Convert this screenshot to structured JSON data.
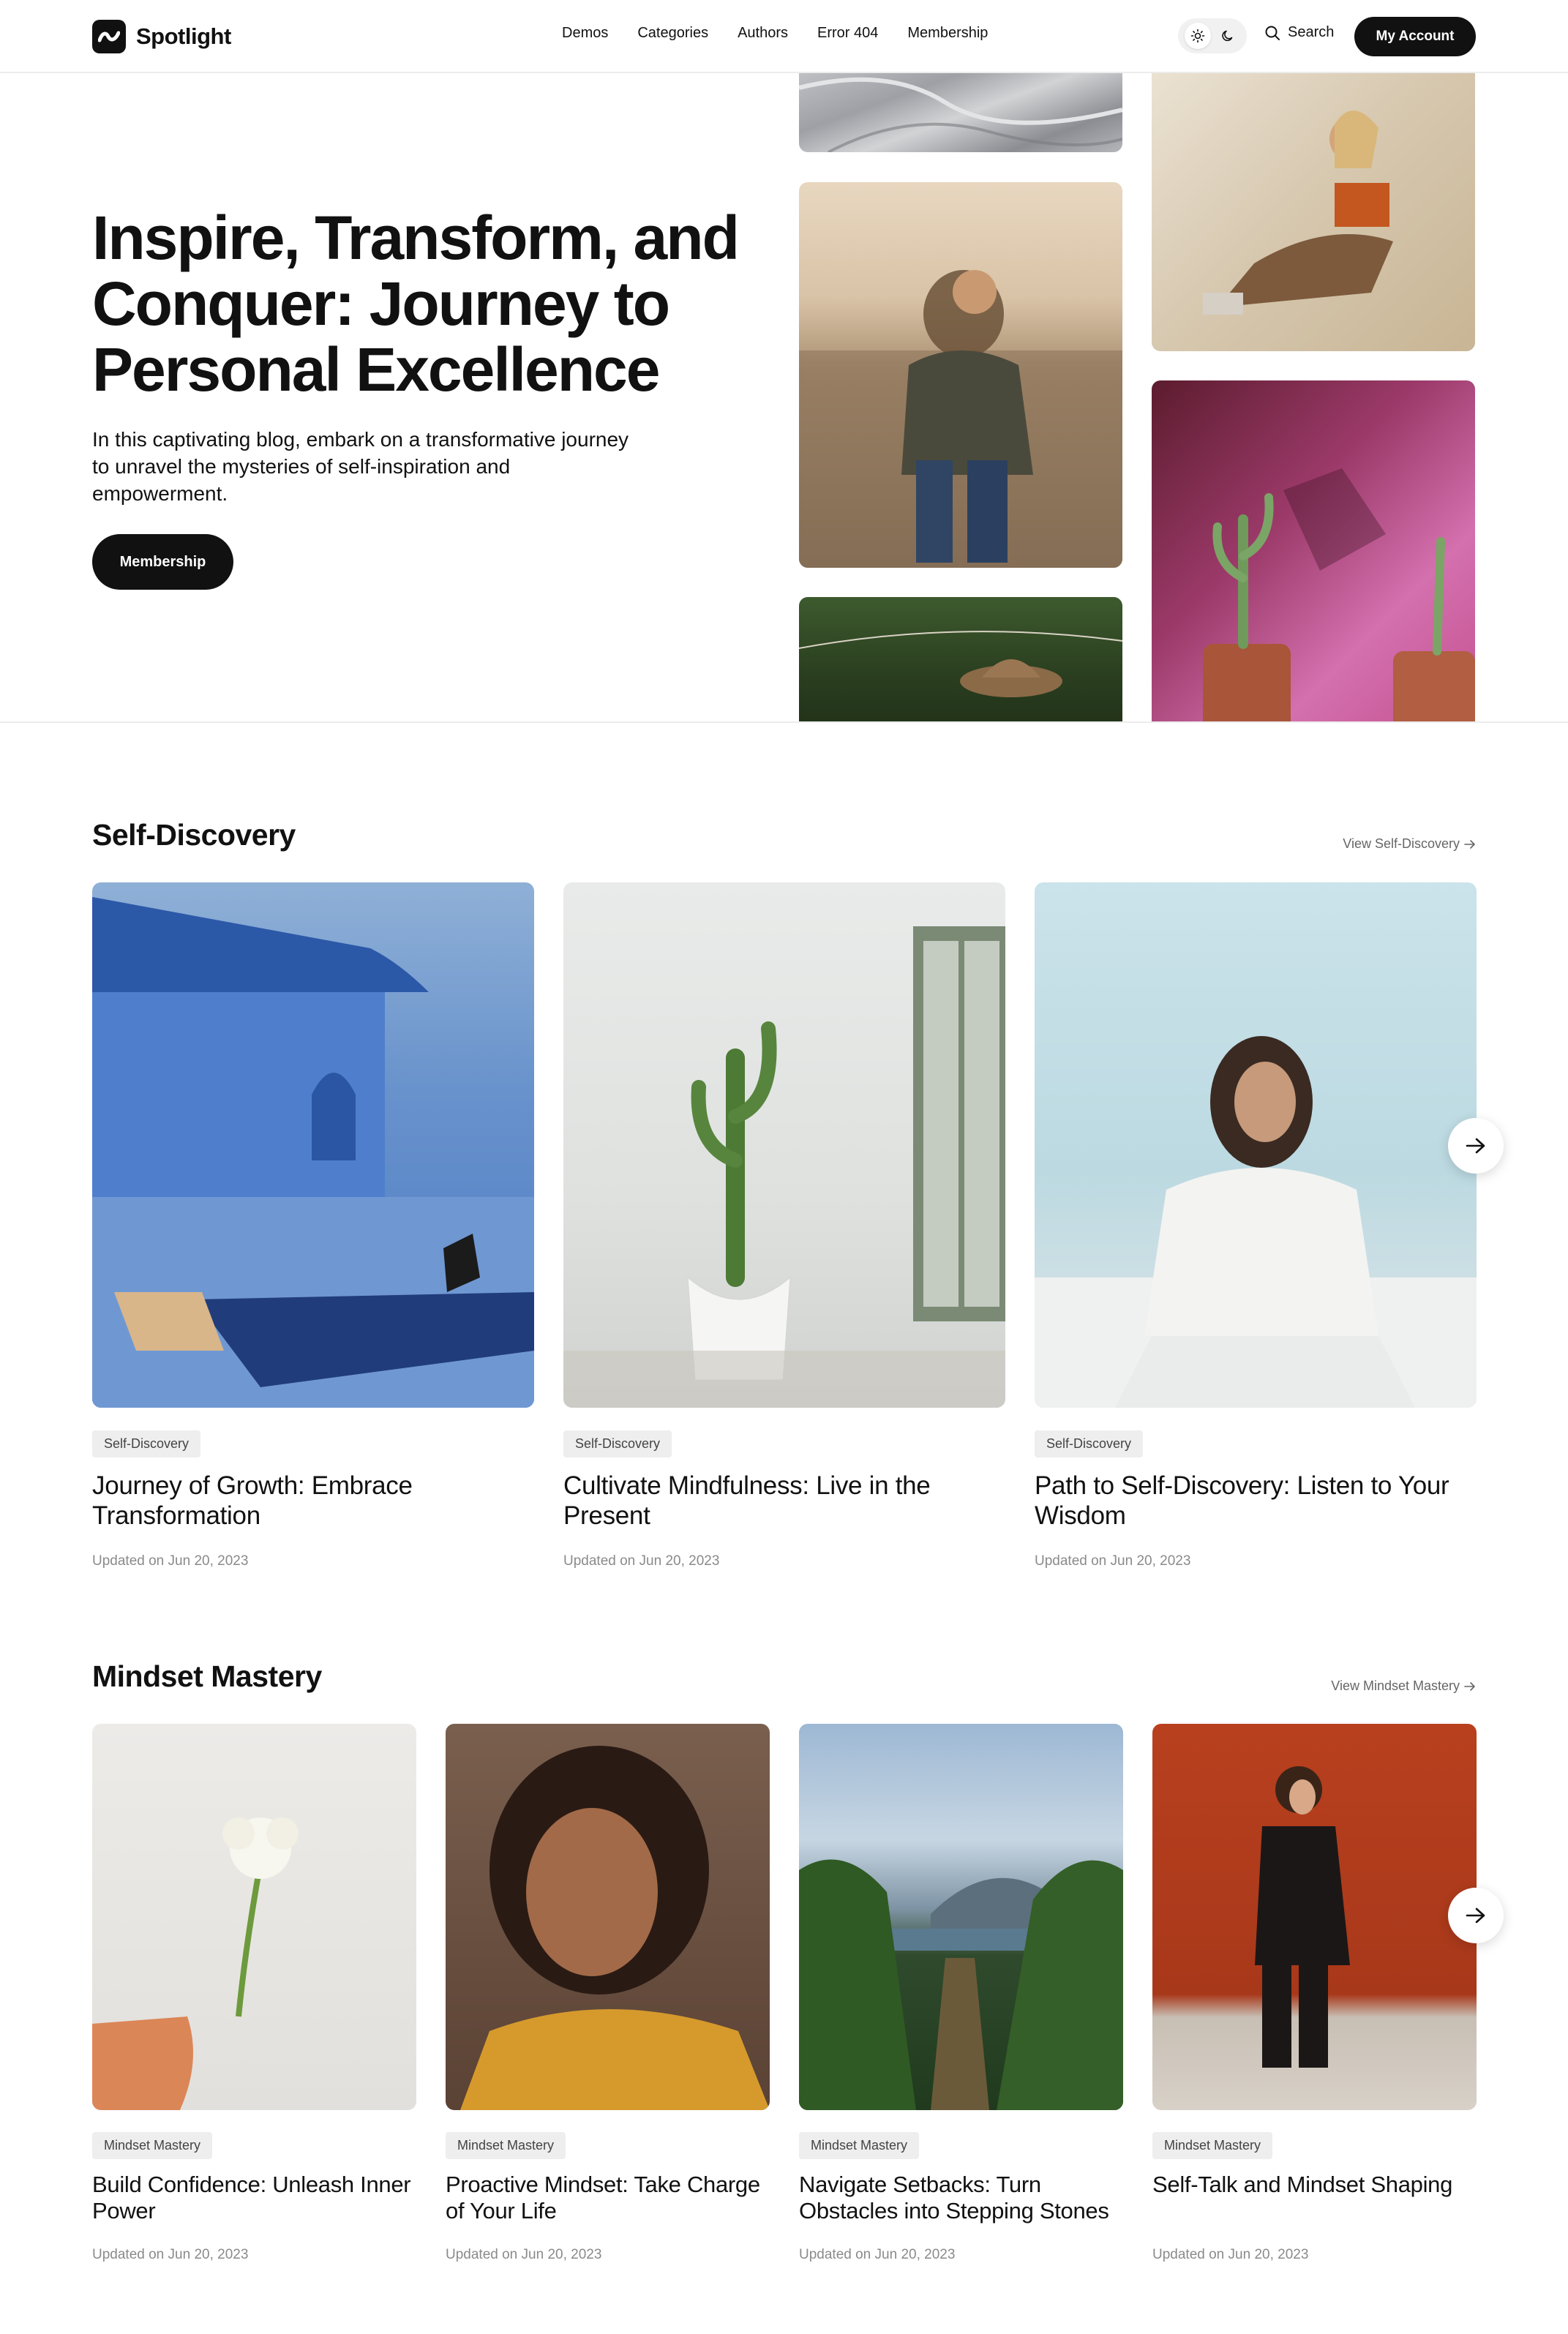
{
  "header": {
    "logo_text": "Spotlight",
    "nav": [
      "Demos",
      "Categories",
      "Authors",
      "Error 404",
      "Membership"
    ],
    "search_label": "Search",
    "account_label": "My Account"
  },
  "hero": {
    "title": "Inspire, Transform, and Conquer: Journey to Personal Excellence",
    "description": "In this captivating blog, embark on a transformative journey to unravel the mysteries of self-inspiration and empowerment.",
    "button_label": "Membership"
  },
  "sections": [
    {
      "title": "Self-Discovery",
      "view_link": "View Self-Discovery",
      "cards": [
        {
          "tag": "Self-Discovery",
          "title": "Journey of Growth: Embrace Transformation",
          "date_prefix": "Updated on",
          "date": "Jun 20, 2023"
        },
        {
          "tag": "Self-Discovery",
          "title": "Cultivate Mindfulness: Live in the Present",
          "date_prefix": "Updated on",
          "date": "Jun 20, 2023"
        },
        {
          "tag": "Self-Discovery",
          "title": "Path to Self-Discovery: Listen to Your Wisdom",
          "date_prefix": "Updated on",
          "date": "Jun 20, 2023"
        }
      ]
    },
    {
      "title": "Mindset Mastery",
      "view_link": "View Mindset Mastery",
      "cards": [
        {
          "tag": "Mindset Mastery",
          "title": "Build Confidence: Unleash Inner Power",
          "date_prefix": "Updated on",
          "date": "Jun 20, 2023"
        },
        {
          "tag": "Mindset Mastery",
          "title": "Proactive Mindset: Take Charge of Your Life",
          "date_prefix": "Updated on",
          "date": "Jun 20, 2023"
        },
        {
          "tag": "Mindset Mastery",
          "title": "Navigate Setbacks: Turn Obstacles into Stepping Stones",
          "date_prefix": "Updated on",
          "date": "Jun 20, 2023"
        },
        {
          "tag": "Mindset Mastery",
          "title": "Self-Talk and Mindset Shaping",
          "date_prefix": "Updated on",
          "date": "Jun 20, 2023"
        }
      ]
    }
  ],
  "icons": {
    "logo": "logo-mark-icon",
    "light_mode": "sun-icon",
    "dark_mode": "moon-icon",
    "search": "search-icon",
    "view_arrow": "arrow-right-icon",
    "carousel_next": "arrow-right-icon"
  }
}
